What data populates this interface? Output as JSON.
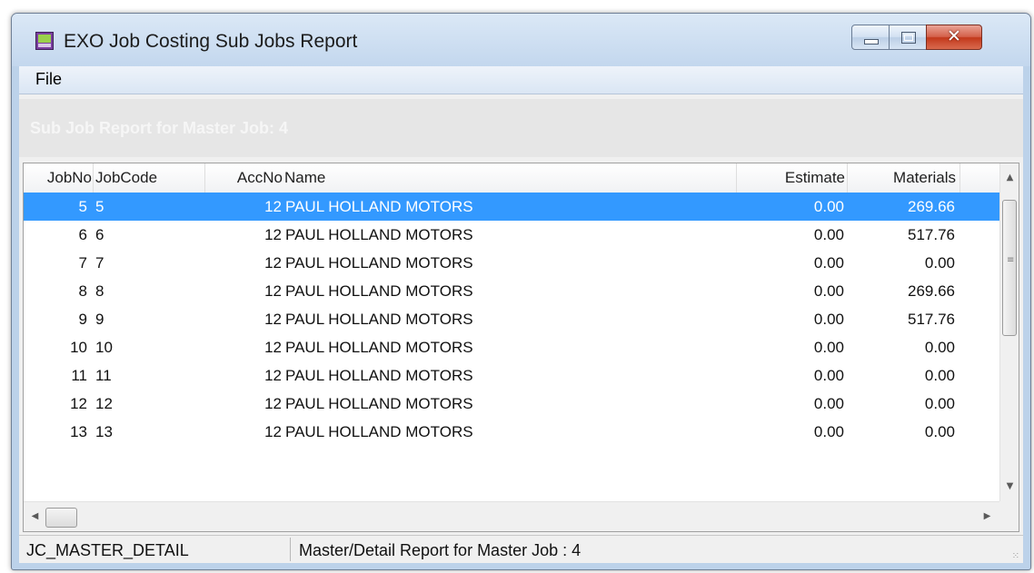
{
  "window": {
    "title": "EXO Job Costing Sub Jobs Report",
    "icon": "app-icon",
    "controls": {
      "minimize": "minimize-icon",
      "maximize": "maximize-icon",
      "close": "close-icon",
      "close_glyph": "✕"
    }
  },
  "menu": {
    "file_label": "File"
  },
  "report": {
    "header_title": "Sub Job Report for Master Job: 4"
  },
  "table": {
    "columns": [
      "JobNo",
      "JobCode",
      "AccNo",
      "Name",
      "Estimate",
      "Materials"
    ],
    "selected_row": 0,
    "rows": [
      {
        "jobno": "5",
        "jobcode": "5",
        "accno": "12",
        "name": "PAUL HOLLAND MOTORS",
        "estimate": "0.00",
        "materials": "269.66"
      },
      {
        "jobno": "6",
        "jobcode": "6",
        "accno": "12",
        "name": "PAUL HOLLAND MOTORS",
        "estimate": "0.00",
        "materials": "517.76"
      },
      {
        "jobno": "7",
        "jobcode": "7",
        "accno": "12",
        "name": "PAUL HOLLAND MOTORS",
        "estimate": "0.00",
        "materials": "0.00"
      },
      {
        "jobno": "8",
        "jobcode": "8",
        "accno": "12",
        "name": "PAUL HOLLAND MOTORS",
        "estimate": "0.00",
        "materials": "269.66"
      },
      {
        "jobno": "9",
        "jobcode": "9",
        "accno": "12",
        "name": "PAUL HOLLAND MOTORS",
        "estimate": "0.00",
        "materials": "517.76"
      },
      {
        "jobno": "10",
        "jobcode": "10",
        "accno": "12",
        "name": "PAUL HOLLAND MOTORS",
        "estimate": "0.00",
        "materials": "0.00"
      },
      {
        "jobno": "11",
        "jobcode": "11",
        "accno": "12",
        "name": "PAUL HOLLAND MOTORS",
        "estimate": "0.00",
        "materials": "0.00"
      },
      {
        "jobno": "12",
        "jobcode": "12",
        "accno": "12",
        "name": "PAUL HOLLAND MOTORS",
        "estimate": "0.00",
        "materials": "0.00"
      },
      {
        "jobno": "13",
        "jobcode": "13",
        "accno": "12",
        "name": "PAUL HOLLAND MOTORS",
        "estimate": "0.00",
        "materials": "0.00"
      }
    ]
  },
  "scrollbars": {
    "up": "▲",
    "down": "▼",
    "left": "◀",
    "right": "▶",
    "grip": "≡"
  },
  "status": {
    "left": "JC_MASTER_DETAIL",
    "right": "Master/Detail Report for Master Job : 4",
    "grip": "⁙"
  },
  "colors": {
    "selection": "#3399ff",
    "title_bar": "#c3d7ee",
    "close_button": "#c2381b"
  }
}
